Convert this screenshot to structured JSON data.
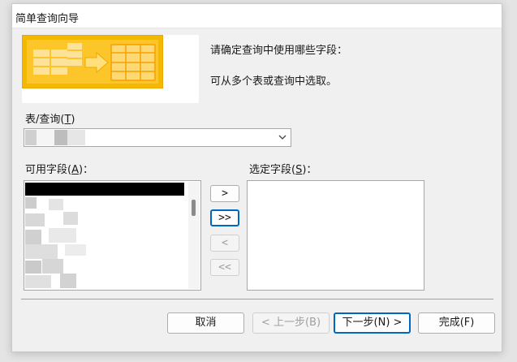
{
  "dialog": {
    "title": "简单查询向导",
    "prompt_line1": "请确定查询中使用哪些字段：",
    "prompt_line2": "可从多个表或查询中选取。"
  },
  "table_query": {
    "label": "表/查询(",
    "hotkey": "T",
    "label_end": ")"
  },
  "available_fields": {
    "label": "可用字段(",
    "hotkey": "A",
    "label_end": ")："
  },
  "selected_fields": {
    "label": "选定字段(",
    "hotkey": "S",
    "label_end": ")："
  },
  "move_buttons": {
    "add_one": ">",
    "add_all": ">>",
    "remove_one": "<",
    "remove_all": "<<"
  },
  "footer": {
    "cancel": "取消",
    "back": "< 上一步(B)",
    "next": "下一步(N) >",
    "finish": "完成(F)"
  },
  "colors": {
    "accent": "#0067c0",
    "wizard_art": "#f5b800"
  }
}
